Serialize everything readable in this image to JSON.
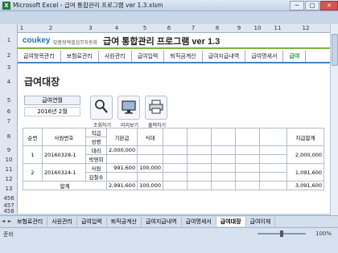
{
  "window": {
    "title": "Microsoft Excel - 급여 통합관리 프로그램 ver 1.3.xlsm",
    "buttons": [
      "─",
      "□",
      "✕"
    ]
  },
  "columns": [
    "1",
    "2",
    "3",
    "4",
    "5",
    "6",
    "7",
    "8",
    "9",
    "10",
    "11",
    "12"
  ],
  "rows": [
    "1",
    "2",
    "3",
    "4",
    "5",
    "6",
    "7",
    "8",
    "9",
    "10",
    "11",
    "12",
    "13",
    "456",
    "457",
    "458"
  ],
  "header": {
    "logo_main": "coukey",
    "logo_sub": "맞춤형엑셀업무자동화",
    "title": "급여 통합관리 프로그램 ver 1.3"
  },
  "menu": [
    "급여항목관리",
    "보험료관리",
    "사원관리",
    "급여입력",
    "퇴직금계산",
    "급여지급내역",
    "급여명세서",
    "급여"
  ],
  "menu_active_index": 7,
  "page": {
    "title": "급여대장",
    "yearmonth_label": "급여연월",
    "yearmonth_value": "2016년 2월"
  },
  "tools": [
    {
      "label": "조회하기",
      "icon": "search-icon"
    },
    {
      "label": "미리보기",
      "icon": "monitor-icon"
    },
    {
      "label": "출력하기",
      "icon": "printer-icon"
    }
  ],
  "table": {
    "headers": {
      "no": "순번",
      "emp_id": "사원번호",
      "position": "직급",
      "name": "성명",
      "base_pay": "기본급",
      "meal": "식대",
      "total": "지급합계"
    },
    "rows": [
      {
        "no": "1",
        "emp_id": "20160328-1",
        "position": "대리",
        "name": "박영희",
        "base_pay": "2,000,000",
        "meal": "",
        "total": "2,000,000"
      },
      {
        "no": "2",
        "emp_id": "20160324-1",
        "position": "사원",
        "name": "김철수",
        "base_pay": "991,600",
        "meal": "100,000",
        "total": "1,091,600"
      }
    ],
    "sum_label": "합계",
    "sum": {
      "base_pay": "2,991,600",
      "meal": "100,000",
      "total": "3,091,600"
    }
  },
  "sheet_tabs": [
    "보험료관리",
    "사원관리",
    "급여입력",
    "퇴직금계산",
    "급여지급내역",
    "급여명세서",
    "급여대장",
    "급여이체"
  ],
  "sheet_tab_active_index": 6,
  "status": {
    "ready": "준비",
    "zoom": "100%"
  }
}
